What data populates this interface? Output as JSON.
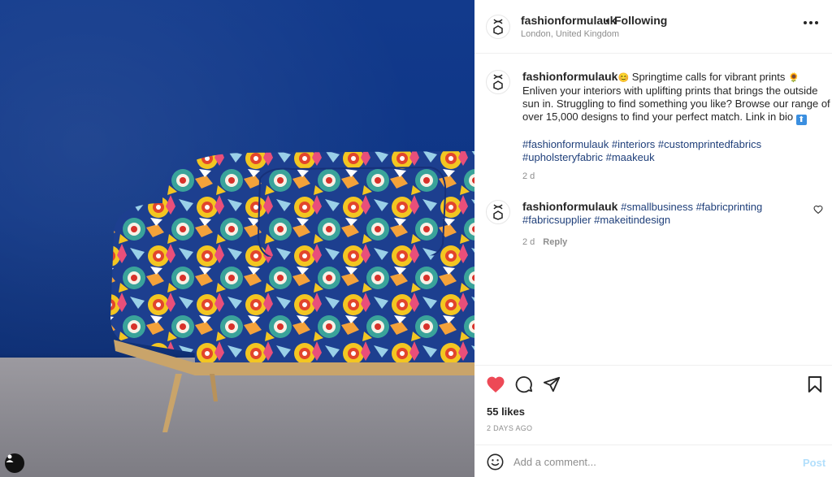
{
  "photo": {
    "alt_icon": "user-tag-icon"
  },
  "post": {
    "username": "fashionformulauk",
    "separator": "•",
    "follow_status": "Following",
    "location": "London, United Kingdom",
    "more_icon": "more-horizontal-icon"
  },
  "caption": {
    "username": "fashionformulauk",
    "emoji_1": "😊",
    "part_1": " Springtime calls for vibrant prints ",
    "emoji_2": "🌻",
    "part_2": " Enliven your interiors with uplifting prints that brings the outside sun in. Struggling to find something you like? Browse our range of over 15,000 designs to find your perfect match. Link in bio ",
    "emoji_3": "⬆",
    "hashtags_line1": "#fashionformulauk #interiors #customprintedfabrics",
    "hashtags_line2": "#upholsteryfabric #maakeuk",
    "time": "2 d"
  },
  "comment": {
    "username": "fashionformulauk",
    "text_line1": "#smallbusiness #fabricprinting",
    "text_line2": "#fabricsupplier #makeitindesign",
    "time": "2 d",
    "reply_label": "Reply"
  },
  "actions": {
    "like_icon": "heart-filled-icon",
    "comment_icon": "comment-icon",
    "share_icon": "send-icon",
    "save_icon": "bookmark-icon",
    "likes": "55 likes",
    "posted": "2 DAYS AGO",
    "like_color": "#ed4956"
  },
  "add_comment": {
    "placeholder": "Add a comment...",
    "post_label": "Post",
    "emoji_icon": "smiley-icon"
  }
}
